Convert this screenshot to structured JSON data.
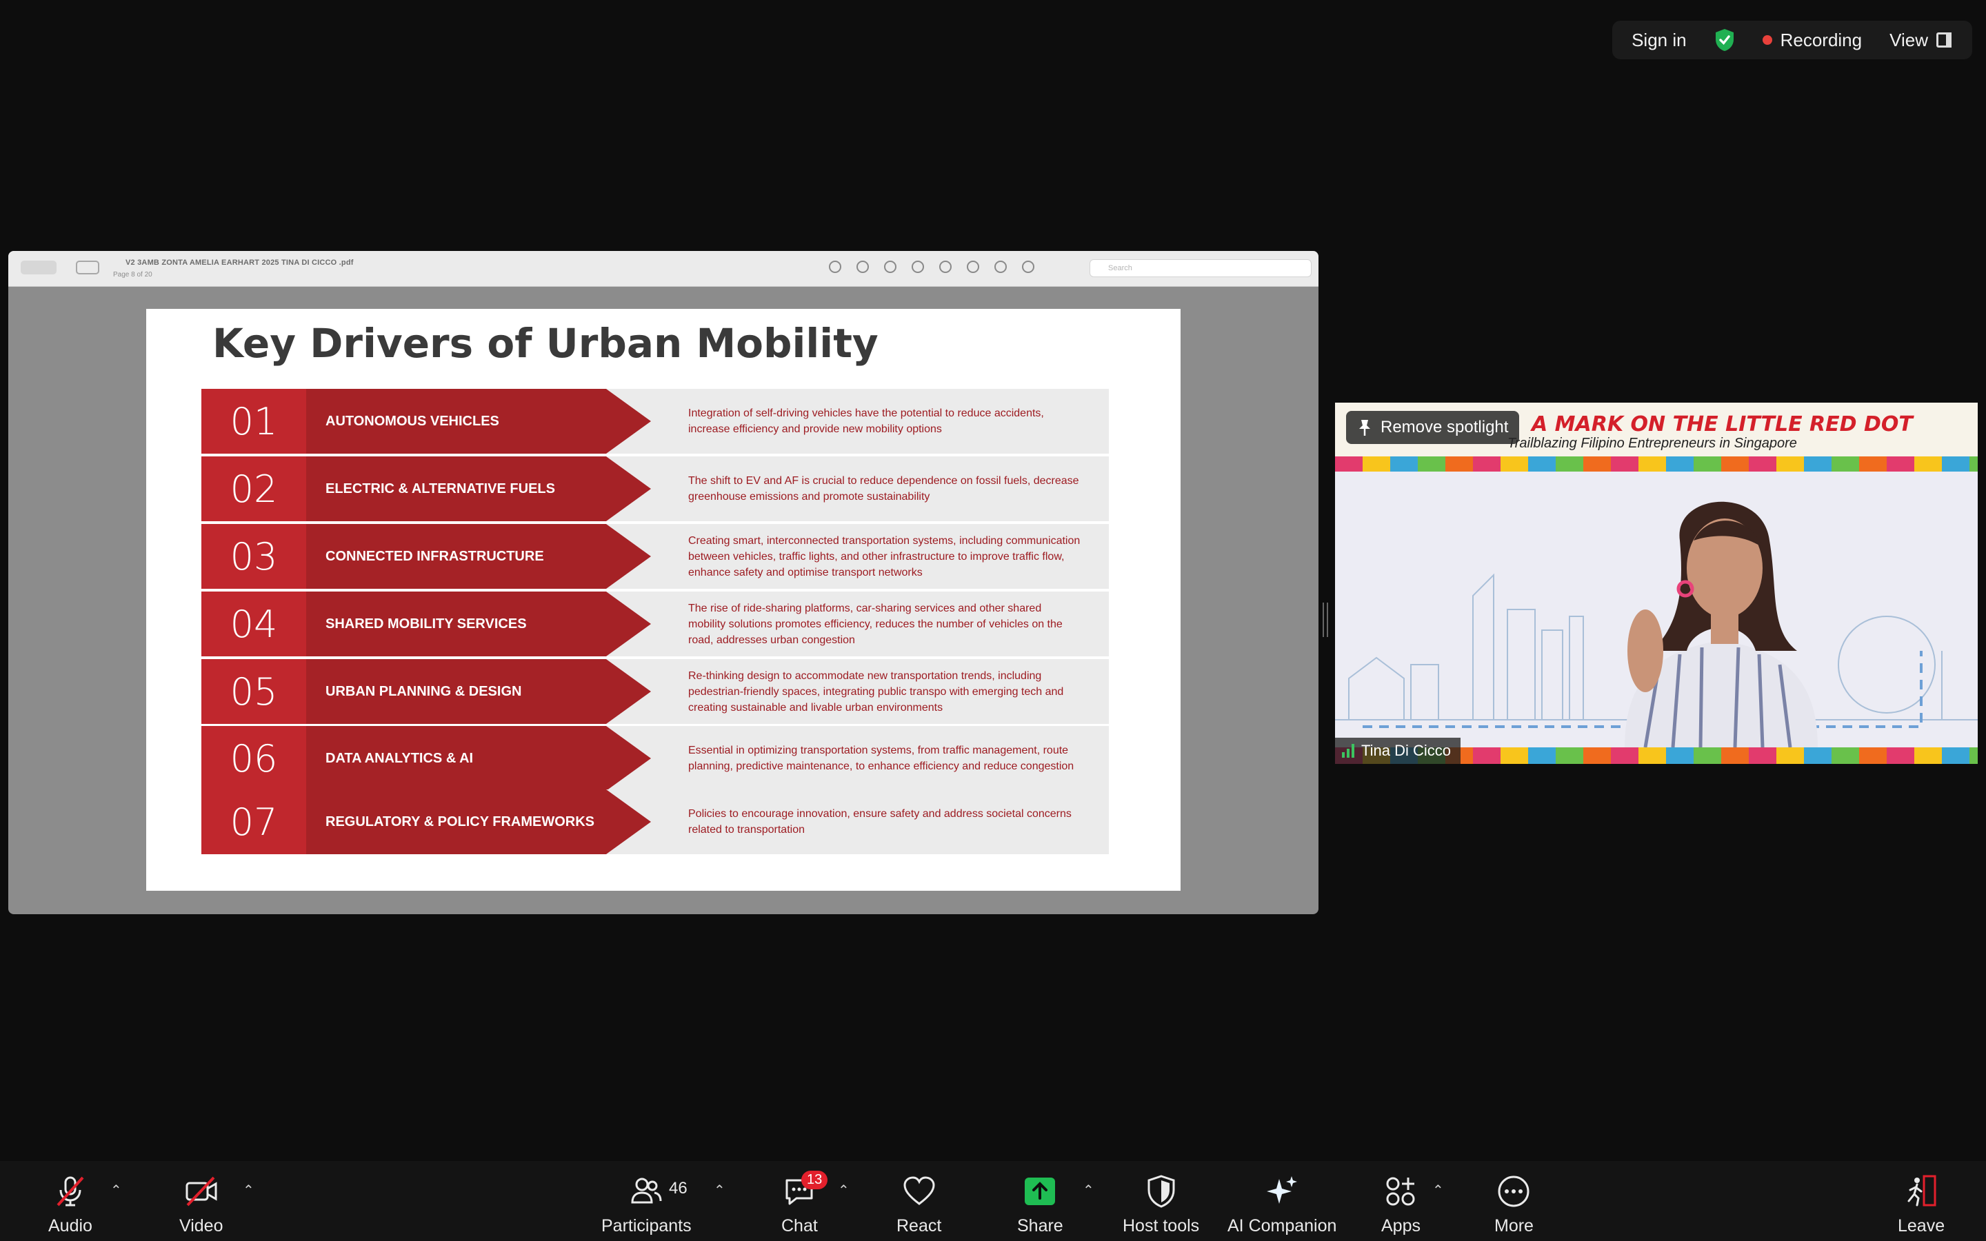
{
  "topbar": {
    "sign_in": "Sign in",
    "recording": "Recording",
    "view": "View"
  },
  "pdf": {
    "title": "V2 3AMB ZONTA AMELIA EARHART 2025 TINA DI CICCO .pdf",
    "page": "Page 8 of 20",
    "search_placeholder": "Search"
  },
  "slide": {
    "title": "Key Drivers of Urban Mobility",
    "rows": [
      {
        "num": "01",
        "label": "AUTONOMOUS VEHICLES",
        "desc": "Integration of self-driving vehicles have the potential to reduce accidents, increase efficiency and provide new mobility options"
      },
      {
        "num": "02",
        "label": "ELECTRIC & ALTERNATIVE FUELS",
        "desc": "The shift to EV and AF is crucial to reduce dependence on fossil fuels, decrease greenhouse emissions and promote sustainability"
      },
      {
        "num": "03",
        "label": "CONNECTED INFRASTRUCTURE",
        "desc": "Creating smart, interconnected transportation systems, including communication between vehicles, traffic lights, and other infrastructure to improve traffic flow, enhance safety and optimise transport networks"
      },
      {
        "num": "04",
        "label": "SHARED MOBILITY SERVICES",
        "desc": "The rise of ride-sharing platforms, car-sharing services and other shared mobility solutions promotes efficiency, reduces the number of vehicles on the road, addresses urban congestion"
      },
      {
        "num": "05",
        "label": "URBAN PLANNING & DESIGN",
        "desc": "Re-thinking design to accommodate new transportation trends, including pedestrian-friendly spaces, integrating public transpo with emerging tech and creating sustainable and livable urban environments"
      },
      {
        "num": "06",
        "label": "DATA ANALYTICS & AI",
        "desc": "Essential in optimizing transportation systems, from traffic management, route planning, predictive maintenance, to enhance efficiency and reduce congestion"
      },
      {
        "num": "07",
        "label": "REGULATORY & POLICY FRAMEWORKS",
        "desc": "Policies to encourage innovation, ensure safety and address societal concerns related to transportation"
      }
    ]
  },
  "video": {
    "banner_title": "A MARK ON THE LITTLE RED DOT",
    "banner_subtitle": "Trailblazing  Filipino Entrepreneurs in Singapore",
    "remove_spotlight": "Remove spotlight",
    "participant_name": "Tina Di Cicco"
  },
  "controls": {
    "audio": "Audio",
    "video": "Video",
    "participants": "Participants",
    "participants_count": "46",
    "chat": "Chat",
    "chat_badge": "13",
    "react": "React",
    "share": "Share",
    "host_tools": "Host tools",
    "ai_companion": "AI Companion",
    "apps": "Apps",
    "more": "More",
    "leave": "Leave"
  },
  "colors": {
    "accent_red": "#c0272d",
    "arrow_red": "#a52226",
    "share_green": "#1fbd53",
    "badge_red": "#e2202c"
  }
}
